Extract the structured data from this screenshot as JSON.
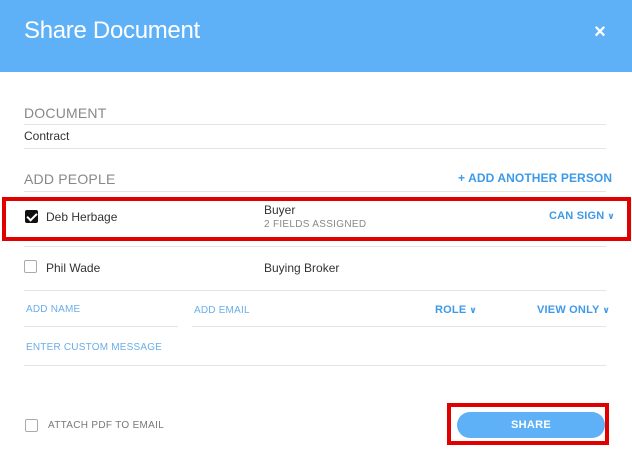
{
  "dialog": {
    "title": "Share Document",
    "close_glyph": "×"
  },
  "document_section": {
    "label": "DOCUMENT",
    "value": "Contract"
  },
  "people_section": {
    "label": "ADD PEOPLE",
    "add_another_label": "+ ADD ANOTHER PERSON"
  },
  "people": [
    {
      "name": "Deb Herbage",
      "checked": true,
      "role": "Buyer",
      "fields_assigned": "2 FIELDS ASSIGNED",
      "permission": "CAN SIGN"
    },
    {
      "name": "Phil Wade",
      "checked": false,
      "role": "Buying Broker",
      "fields_assigned": "",
      "permission": ""
    }
  ],
  "new_person": {
    "name_placeholder": "ADD NAME",
    "email_placeholder": "ADD EMAIL",
    "role_label": "ROLE",
    "permission_label": "VIEW ONLY",
    "message_placeholder": "ENTER CUSTOM MESSAGE"
  },
  "footer": {
    "attach_pdf_label": "ATTACH PDF TO EMAIL",
    "attach_pdf_checked": false,
    "share_label": "SHARE"
  },
  "colors": {
    "header": "#5eb1f7",
    "accent": "#3d9ae8",
    "highlight": "#e00000"
  }
}
